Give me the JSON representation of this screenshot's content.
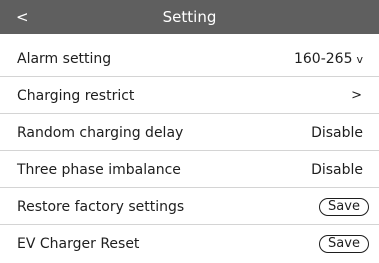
{
  "header": {
    "back_label": "<",
    "title": "Setting"
  },
  "rows": {
    "alarm": {
      "label": "Alarm setting",
      "value": "160-265",
      "chevron": "v"
    },
    "charging_restrict": {
      "label": "Charging restrict",
      "arrow": ">"
    },
    "random_delay": {
      "label": "Random charging delay",
      "value": "Disable"
    },
    "phase_imbalance": {
      "label": "Three phase imbalance",
      "value": "Disable"
    },
    "restore": {
      "label": "Restore factory settings",
      "button": "Save"
    },
    "reset": {
      "label": "EV Charger Reset",
      "button": "Save"
    }
  }
}
